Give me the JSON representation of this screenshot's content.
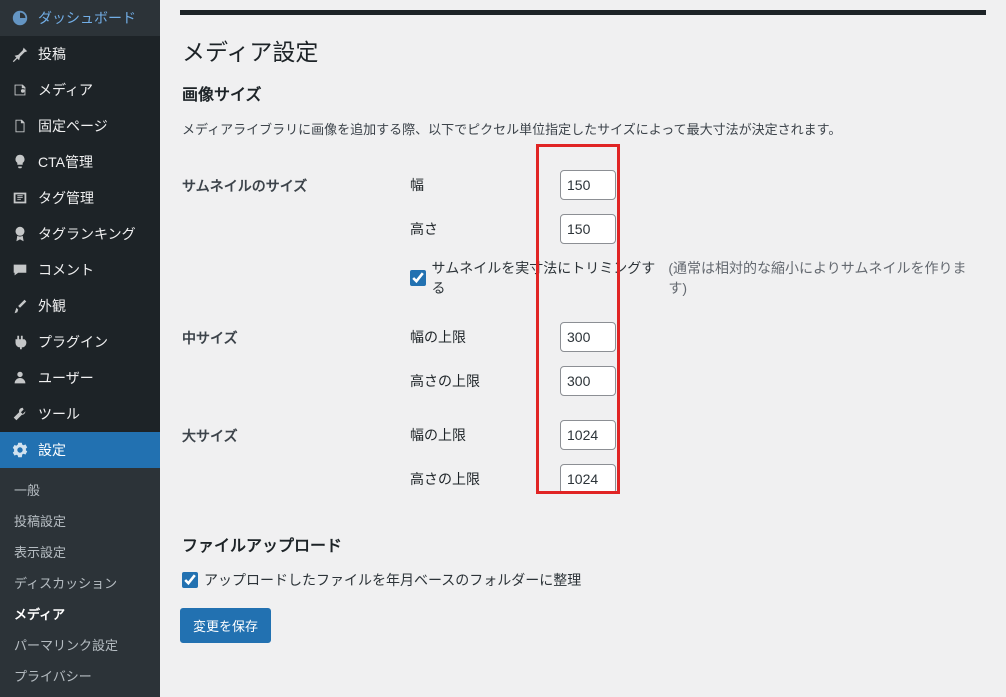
{
  "sidebar": {
    "items": [
      {
        "label": "ダッシュボード",
        "icon": "dashboard-icon"
      },
      {
        "label": "投稿",
        "icon": "pin-icon"
      },
      {
        "label": "メディア",
        "icon": "media-icon"
      },
      {
        "label": "固定ページ",
        "icon": "page-icon"
      },
      {
        "label": "CTA管理",
        "icon": "bulb-icon"
      },
      {
        "label": "タグ管理",
        "icon": "tag-icon"
      },
      {
        "label": "タグランキング",
        "icon": "award-icon"
      },
      {
        "label": "コメント",
        "icon": "comment-icon"
      },
      {
        "label": "外観",
        "icon": "brush-icon"
      },
      {
        "label": "プラグイン",
        "icon": "plugin-icon"
      },
      {
        "label": "ユーザー",
        "icon": "user-icon"
      },
      {
        "label": "ツール",
        "icon": "tool-icon"
      },
      {
        "label": "設定",
        "icon": "settings-icon"
      }
    ],
    "submenu": [
      {
        "label": "一般"
      },
      {
        "label": "投稿設定"
      },
      {
        "label": "表示設定"
      },
      {
        "label": "ディスカッション"
      },
      {
        "label": "メディア"
      },
      {
        "label": "パーマリンク設定"
      },
      {
        "label": "プライバシー"
      }
    ]
  },
  "page": {
    "title": "メディア設定",
    "image_sizes_heading": "画像サイズ",
    "image_sizes_desc": "メディアライブラリに画像を追加する際、以下でピクセル単位指定したサイズによって最大寸法が決定されます。",
    "thumbnail": {
      "row_label": "サムネイルのサイズ",
      "width_label": "幅",
      "width_value": "150",
      "height_label": "高さ",
      "height_value": "150",
      "crop_checked": true,
      "crop_label": "サムネイルを実寸法にトリミングする",
      "crop_hint": "(通常は相対的な縮小によりサムネイルを作ります)"
    },
    "medium": {
      "row_label": "中サイズ",
      "width_label": "幅の上限",
      "width_value": "300",
      "height_label": "高さの上限",
      "height_value": "300"
    },
    "large": {
      "row_label": "大サイズ",
      "width_label": "幅の上限",
      "width_value": "1024",
      "height_label": "高さの上限",
      "height_value": "1024"
    },
    "upload_heading": "ファイルアップロード",
    "upload_checked": true,
    "upload_label": "アップロードしたファイルを年月ベースのフォルダーに整理",
    "save_button": "変更を保存"
  }
}
